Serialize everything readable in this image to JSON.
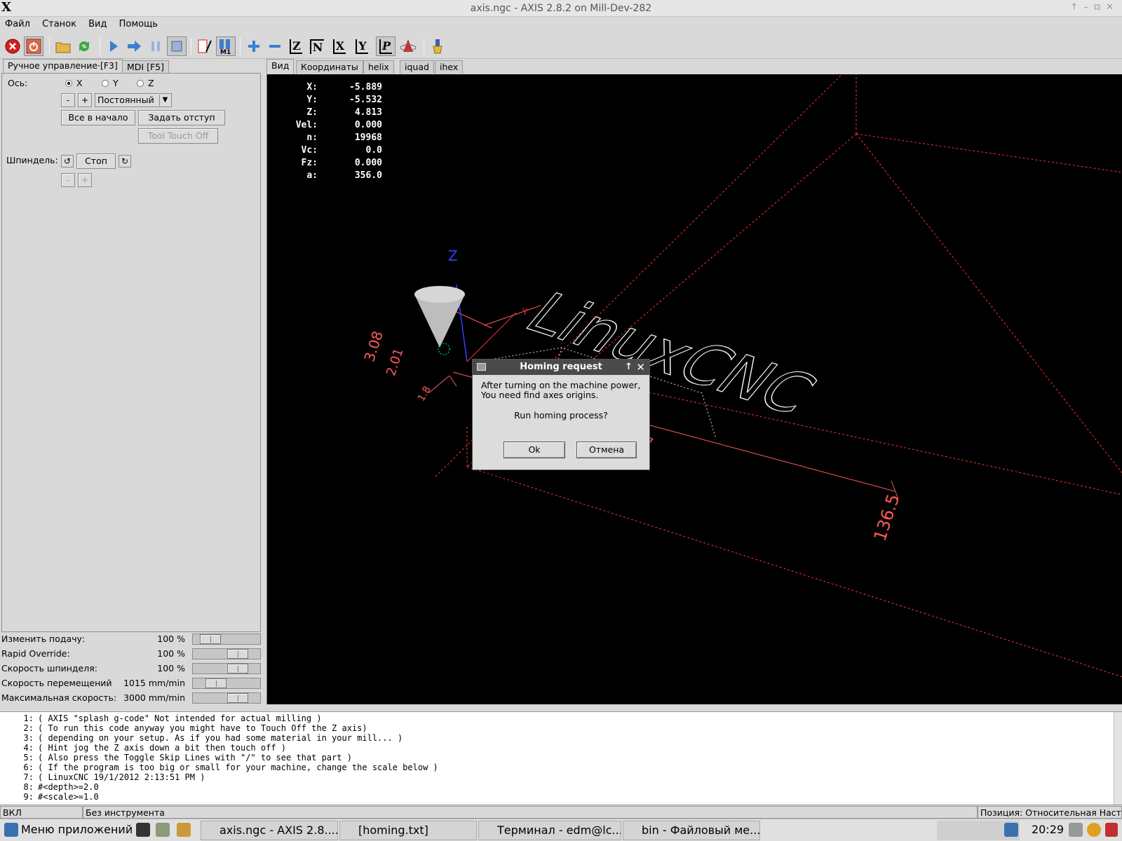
{
  "window": {
    "title": "axis.ngc - AXIS 2.8.2 on Mill-Dev-282"
  },
  "menu": [
    "Файл",
    "Станок",
    "Вид",
    "Помощь"
  ],
  "toolbar_icons": [
    "estop-icon",
    "power-icon",
    "open-file-icon",
    "reload-icon",
    "run-icon",
    "step-icon",
    "pause-icon",
    "stop-icon",
    "skip-lines-icon",
    "optional-stop-icon",
    "zoom-in-icon",
    "zoom-out-icon",
    "view-z-icon",
    "view-z2-icon",
    "view-x-icon",
    "view-y-icon",
    "view-p-icon",
    "rotate-icon",
    "clear-backplot-icon"
  ],
  "left_tabs": [
    "Ручное управление·[F3]",
    "MDI [F5]"
  ],
  "manual": {
    "axis_label": "Ось:",
    "axes": [
      "X",
      "Y",
      "Z"
    ],
    "selected_axis": "X",
    "jog_minus": "-",
    "jog_plus": "+",
    "jog_mode": "Постоянный",
    "home_all": "Все в начало",
    "touch_off": "Задать отступ",
    "tool_touch_off": "Tool Touch Off",
    "spindle_label": "Шпиндель:",
    "spindle_stop": "Стоп",
    "spindle_minus": "-",
    "spindle_plus": "+"
  },
  "sliders": [
    {
      "label": "Изменить подачу:",
      "value": "100 %",
      "level": 0.15
    },
    {
      "label": "Rapid Override:",
      "value": "100 %",
      "level": 0.74
    },
    {
      "label": "Скорость шпинделя:",
      "value": "100 %",
      "level": 0.74
    },
    {
      "label": "Скорость перемещений",
      "value": "1015 mm/min",
      "level": 0.28
    },
    {
      "label": "Максимальная скорость:",
      "value": "3000 mm/min",
      "level": 0.74
    }
  ],
  "right_tabs": [
    "Вид",
    "Координаты",
    "helix",
    "iquad",
    "ihex"
  ],
  "dro": [
    {
      "k": "X:",
      "v": "-5.889"
    },
    {
      "k": "Y:",
      "v": "-5.532"
    },
    {
      "k": "Z:",
      "v": "4.813"
    },
    {
      "k": "Vel:",
      "v": "0.000"
    },
    {
      "k": "n:",
      "v": "19968"
    },
    {
      "k": "Vc:",
      "v": "0.0"
    },
    {
      "k": "Fz:",
      "v": "0.000"
    },
    {
      "k": "a:",
      "v": "356.0"
    }
  ],
  "view": {
    "axis_z": "Z",
    "axis_y": "Y",
    "dim_main": "136.5",
    "dim_small": "4.7",
    "dim_a": "3.08",
    "dim_b": "2.01",
    "dim_c": "1.8",
    "logo_text": "LinuxCNC",
    "colors": {
      "limits": "#ff3030",
      "dims": "#ff5a5a",
      "logo": "#ffffff",
      "axis_z": "#3a3aff",
      "tool": "#c8c8c8"
    }
  },
  "dialog": {
    "title": "Homing request",
    "line1": "After turning on the machine power,",
    "line2": "You need find axes origins.",
    "question": "Run homing process?",
    "ok": "Ok",
    "cancel": "Отмена"
  },
  "code_lines": [
    {
      "n": "1:",
      "t": "( AXIS \"splash g-code\" Not intended for actual milling )"
    },
    {
      "n": "2:",
      "t": "( To run this code anyway you might have to Touch Off the Z axis)"
    },
    {
      "n": "3:",
      "t": "( depending on your setup. As if you had some material in your mill... )"
    },
    {
      "n": "4:",
      "t": "( Hint jog the Z axis down a bit then touch off )"
    },
    {
      "n": "5:",
      "t": "( Also press the Toggle Skip Lines with \"/\" to see that part )"
    },
    {
      "n": "6:",
      "t": "( If the program is too big or small for your machine, change the scale below )"
    },
    {
      "n": "7:",
      "t": "( LinuxCNC 19/1/2012 2:13:51 PM )"
    },
    {
      "n": "8:",
      "t": "#<depth>=2.0"
    },
    {
      "n": "9:",
      "t": "#<scale>=1.0"
    }
  ],
  "status": {
    "state": "ВКЛ",
    "tool": "Без инструмента",
    "position": "Позиция: Относительная Наст"
  },
  "taskbar": {
    "menu": "Меню приложений",
    "items": [
      "axis.ngc - AXIS 2.8....",
      "[homing.txt]",
      "Терминал - edm@lc...",
      "bin - Файловый ме..."
    ],
    "clock": "20:29"
  }
}
